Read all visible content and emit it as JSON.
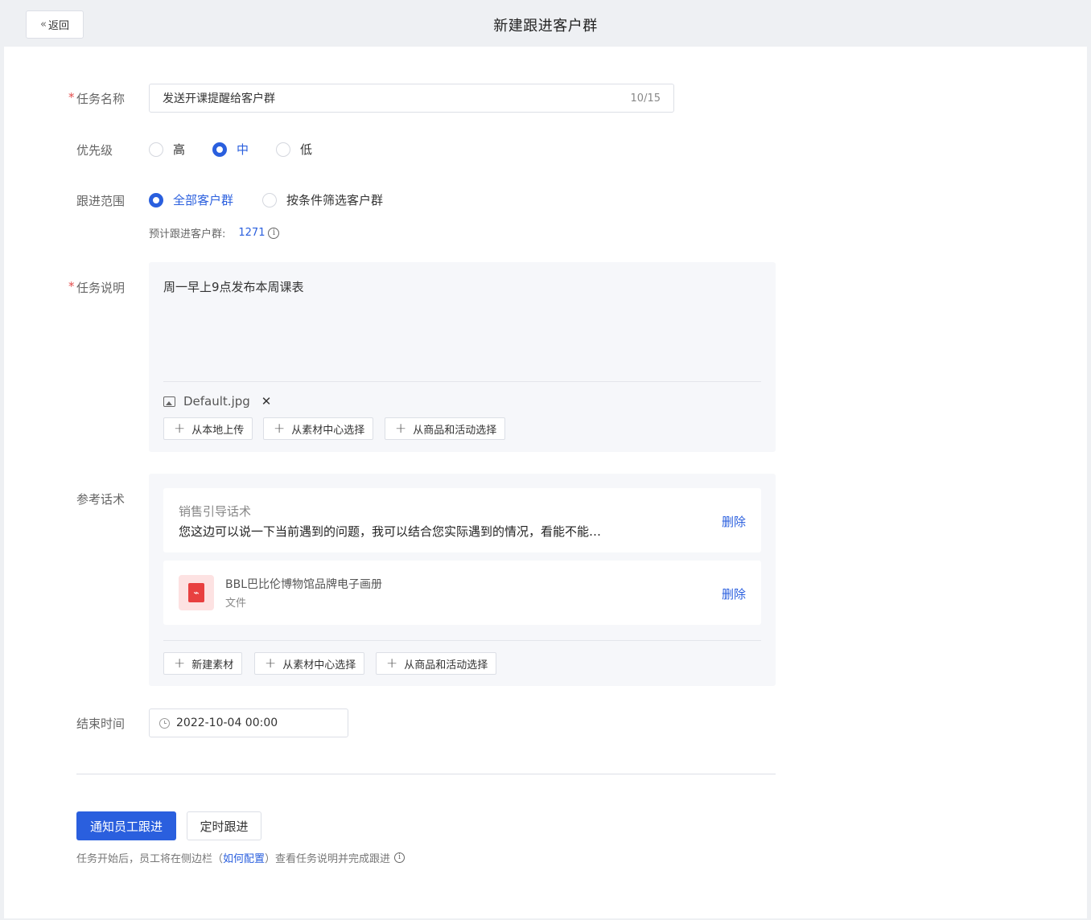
{
  "header": {
    "back_label": "返回",
    "title": "新建跟进客户群"
  },
  "form": {
    "task_name": {
      "label": "任务名称",
      "value": "发送开课提醒给客户群",
      "counter": "10/15"
    },
    "priority": {
      "label": "优先级",
      "options": [
        "高",
        "中",
        "低"
      ],
      "selected": "中"
    },
    "scope": {
      "label": "跟进范围",
      "options": [
        "全部客户群",
        "按条件筛选客户群"
      ],
      "selected": "全部客户群",
      "estimate_label": "预计跟进客户群:",
      "estimate_value": "1271"
    },
    "description": {
      "label": "任务说明",
      "text": "周一早上9点发布本周课表",
      "attachment": "Default.jpg",
      "buttons": [
        "从本地上传",
        "从素材中心选择",
        "从商品和活动选择"
      ]
    },
    "reference": {
      "label": "参考话术",
      "cards": [
        {
          "title": "销售引导话术",
          "content": "您这边可以说一下当前遇到的问题，我可以结合您实际遇到的情况，看能不能…",
          "delete_label": "删除"
        },
        {
          "file_name": "BBL巴比伦博物馆品牌电子画册",
          "file_type": "文件",
          "delete_label": "删除"
        }
      ],
      "buttons": [
        "新建素材",
        "从素材中心选择",
        "从商品和活动选择"
      ]
    },
    "end_time": {
      "label": "结束时间",
      "value": "2022-10-04 00:00"
    }
  },
  "actions": {
    "notify_label": "通知员工跟进",
    "schedule_label": "定时跟进",
    "note_before": "任务开始后，员工将在侧边栏（",
    "note_link": "如何配置",
    "note_after": "）查看任务说明并完成跟进"
  },
  "colors": {
    "accent": "#2a5fde",
    "required": "#e34d4d",
    "panel_bg": "#f6f7fa"
  }
}
